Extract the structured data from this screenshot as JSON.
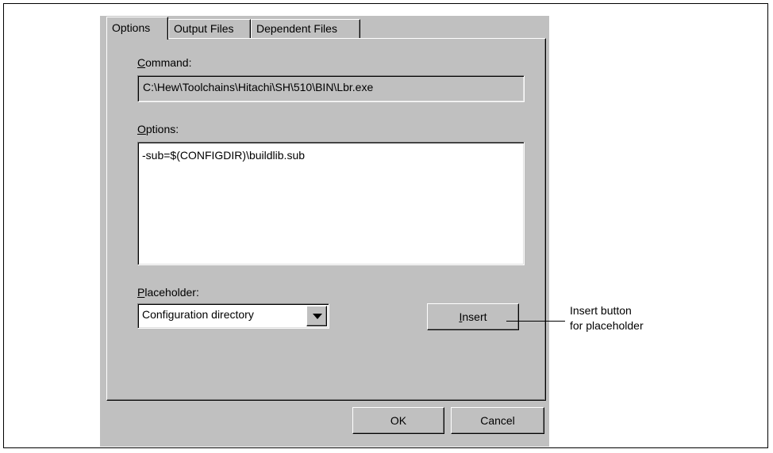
{
  "tabs": [
    {
      "label": "Options",
      "active": true
    },
    {
      "label": "Output Files",
      "active": false
    },
    {
      "label": "Dependent Files",
      "active": false
    }
  ],
  "command": {
    "label_accel": "C",
    "label_rest": "ommand:",
    "value": "C:\\Hew\\Toolchains\\Hitachi\\SH\\510\\BIN\\Lbr.exe"
  },
  "options": {
    "label_accel": "O",
    "label_rest": "ptions:",
    "value": "-sub=$(CONFIGDIR)\\buildlib.sub"
  },
  "placeholder": {
    "label_accel": "P",
    "label_rest": "laceholder:",
    "selected": "Configuration directory"
  },
  "insert_button": {
    "accel": "I",
    "rest": "nsert"
  },
  "footer": {
    "ok_label": "OK",
    "cancel_label": "Cancel"
  },
  "annotation": {
    "line1": "Insert button",
    "line2": "for placeholder"
  }
}
